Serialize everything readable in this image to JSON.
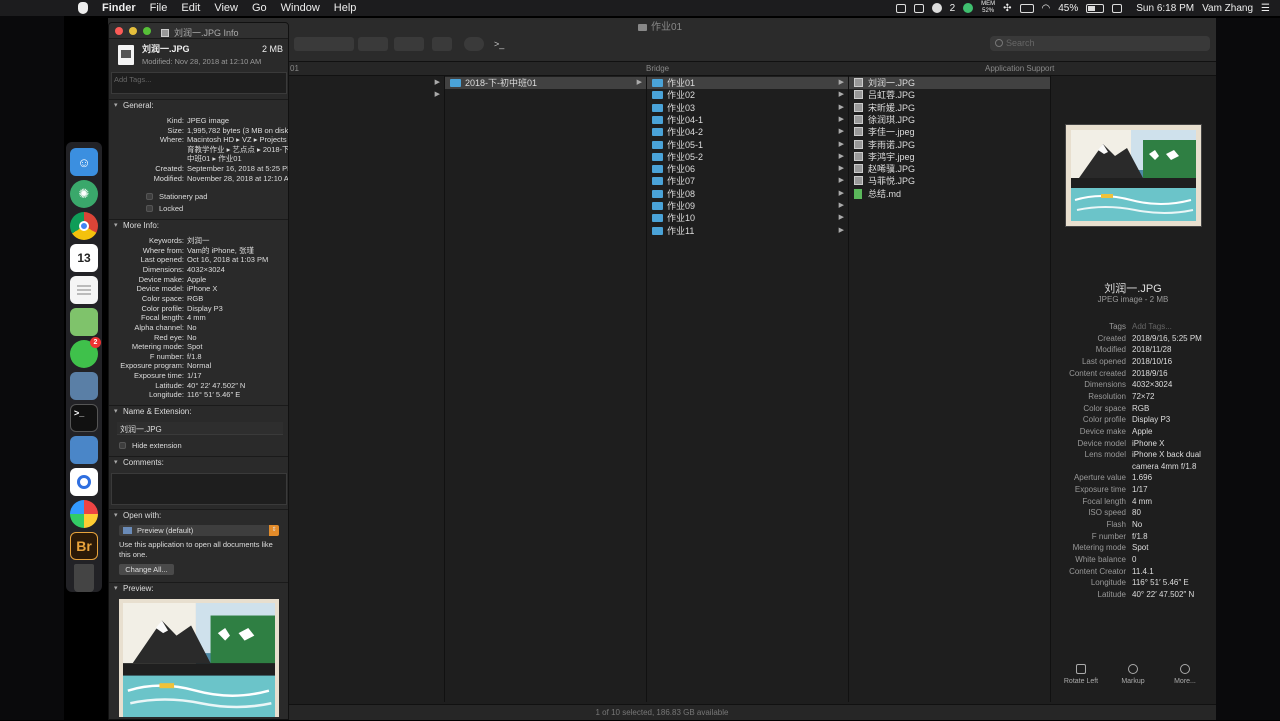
{
  "menubar": {
    "app_name": "Finder",
    "items": [
      "File",
      "Edit",
      "View",
      "Go",
      "Window",
      "Help"
    ],
    "mem_label": "MEM",
    "mem_value": "52%",
    "notify_count": "2",
    "battery": "45%",
    "datetime": "Sun 6:18 PM",
    "user": "Vam Zhang"
  },
  "dock": {
    "calendar_day": "13",
    "badge": "2",
    "bridge_label": "Br"
  },
  "finder": {
    "window_title": "作业01",
    "search_placeholder": "Search",
    "path_items": [
      "01",
      "Bridge",
      "Application Support"
    ],
    "column1": {
      "items": [
        "2018-下-初中班01"
      ]
    },
    "column2": {
      "items": [
        "作业01",
        "作业02",
        "作业03",
        "作业04-1",
        "作业04-2",
        "作业05-1",
        "作业05-2",
        "作业06",
        "作业07",
        "作业08",
        "作业09",
        "作业10",
        "作业11"
      ]
    },
    "column3": {
      "items": [
        "刘润一.JPG",
        "吕虹蓉.JPG",
        "宋昕媛.JPG",
        "徐润琪.JPG",
        "李佳一.jpeg",
        "李雨诺.JPG",
        "李鸿宇.jpeg",
        "赵唏骥.JPG",
        "马菲悦.JPG",
        "总结.md"
      ]
    },
    "status": "1 of 10 selected, 186.83 GB available",
    "preview": {
      "title": "刘润一.JPG",
      "subtitle": "JPEG image - 2 MB",
      "metadata": [
        {
          "k": "Tags",
          "v": "Add Tags..."
        },
        {
          "k": "Created",
          "v": "2018/9/16, 5:25 PM"
        },
        {
          "k": "Modified",
          "v": "2018/11/28"
        },
        {
          "k": "Last opened",
          "v": "2018/10/16"
        },
        {
          "k": "Content created",
          "v": "2018/9/16"
        },
        {
          "k": "Dimensions",
          "v": "4032×3024"
        },
        {
          "k": "Resolution",
          "v": "72×72"
        },
        {
          "k": "Color space",
          "v": "RGB"
        },
        {
          "k": "Color profile",
          "v": "Display P3"
        },
        {
          "k": "Device make",
          "v": "Apple"
        },
        {
          "k": "Device model",
          "v": "iPhone X"
        },
        {
          "k": "Lens model",
          "v": "iPhone X back dual"
        },
        {
          "k": "",
          "v": "camera 4mm f/1.8"
        },
        {
          "k": "Aperture value",
          "v": "1.696"
        },
        {
          "k": "Exposure time",
          "v": "1/17"
        },
        {
          "k": "Focal length",
          "v": "4 mm"
        },
        {
          "k": "ISO speed",
          "v": "80"
        },
        {
          "k": "Flash",
          "v": "No"
        },
        {
          "k": "F number",
          "v": "f/1.8"
        },
        {
          "k": "Metering mode",
          "v": "Spot"
        },
        {
          "k": "White balance",
          "v": "0"
        },
        {
          "k": "Content Creator",
          "v": "11.4.1"
        },
        {
          "k": "Longitude",
          "v": "116° 51′ 5.46″ E"
        },
        {
          "k": "Latitude",
          "v": "40° 22′ 47.502″ N"
        }
      ],
      "actions": [
        "Rotate Left",
        "Markup",
        "More..."
      ]
    }
  },
  "info": {
    "window_title": "刘润一.JPG Info",
    "filename": "刘润一.JPG",
    "size": "2 MB",
    "modified": "Modified: Nov 28, 2018 at 12:10 AM",
    "tags_placeholder": "Add Tags...",
    "sections": {
      "general": "General:",
      "more_info": "More Info:",
      "name_ext": "Name & Extension:",
      "comments": "Comments:",
      "open_with": "Open with:",
      "preview": "Preview:"
    },
    "general": [
      {
        "k": "Kind:",
        "v": "JPEG image"
      },
      {
        "k": "Size:",
        "v": "1,995,782 bytes (3 MB on disk)"
      },
      {
        "k": "Where:",
        "v": "Macintosh HD ▸ VZ ▸ Projects ▸ 美"
      },
      {
        "k": "",
        "v": "育教学作业 ▸ 艺点点 ▸ 2018-下-初"
      },
      {
        "k": "",
        "v": "中班01 ▸ 作业01"
      },
      {
        "k": "Created:",
        "v": "September 16, 2018 at 5:25 PM"
      },
      {
        "k": "Modified:",
        "v": "November 28, 2018 at 12:10 AM"
      }
    ],
    "stationery": "Stationery pad",
    "locked": "Locked",
    "more_info": [
      {
        "k": "Keywords:",
        "v": "刘润一"
      },
      {
        "k": "Where from:",
        "v": "Vam的 iPhone, 张瑾"
      },
      {
        "k": "Last opened:",
        "v": "Oct 16, 2018 at 1:03 PM"
      },
      {
        "k": "Dimensions:",
        "v": "4032×3024"
      },
      {
        "k": "Device make:",
        "v": "Apple"
      },
      {
        "k": "Device model:",
        "v": "iPhone X"
      },
      {
        "k": "Color space:",
        "v": "RGB"
      },
      {
        "k": "Color profile:",
        "v": "Display P3"
      },
      {
        "k": "Focal length:",
        "v": "4 mm"
      },
      {
        "k": "Alpha channel:",
        "v": "No"
      },
      {
        "k": "Red eye:",
        "v": "No"
      },
      {
        "k": "Metering mode:",
        "v": "Spot"
      },
      {
        "k": "F number:",
        "v": "f/1.8"
      },
      {
        "k": "Exposure program:",
        "v": "Normal"
      },
      {
        "k": "Exposure time:",
        "v": "1/17"
      },
      {
        "k": "Latitude:",
        "v": "40° 22′ 47.502″ N"
      },
      {
        "k": "Longitude:",
        "v": "116° 51′ 5.46″ E"
      }
    ],
    "name_value": "刘润一.JPG",
    "hide_extension": "Hide extension",
    "open_with_app": "Preview (default)",
    "open_with_note": "Use this application to open all documents like this one.",
    "change_all": "Change All..."
  }
}
